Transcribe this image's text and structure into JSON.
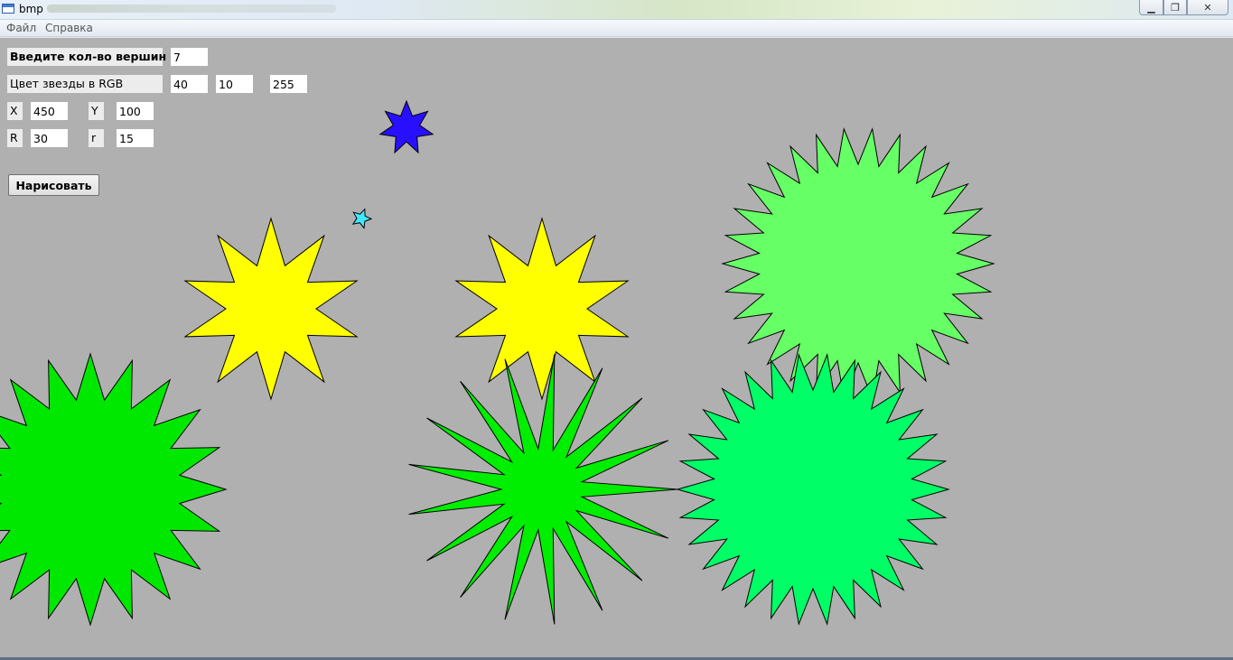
{
  "window": {
    "title": "bmp",
    "controls": {
      "minimize": "▁",
      "maximize": "❐",
      "close": "✕"
    }
  },
  "menu": {
    "items": [
      "Файл",
      "Справка"
    ]
  },
  "form": {
    "vertices_label": "Введите кол-во вершин",
    "vertices_value": "7",
    "color_label": "Цвет звезды в RGB",
    "color_r": "40",
    "color_g": "10",
    "color_b": "255",
    "x_label": "X",
    "x_value": "450",
    "y_label": "Y",
    "y_value": "100",
    "R_label": "R",
    "R_value": "30",
    "r_label": "r",
    "r_value": "15",
    "draw_button": "Нарисовать"
  },
  "canvas": {
    "background": "#b0b0b0",
    "stars": [
      {
        "vertices": 7,
        "color": "#2810ff"
      },
      {
        "vertices": 5,
        "color": "#40e8ff"
      },
      {
        "vertices": 10,
        "color": "#ffff00"
      },
      {
        "vertices": 10,
        "color": "#ffff00"
      },
      {
        "vertices": 30,
        "color": "#66ff66"
      },
      {
        "vertices": 17,
        "color": "#00ee00"
      },
      {
        "vertices": 20,
        "color": "#00e800"
      },
      {
        "vertices": 30,
        "color": "#00ff66"
      }
    ]
  }
}
